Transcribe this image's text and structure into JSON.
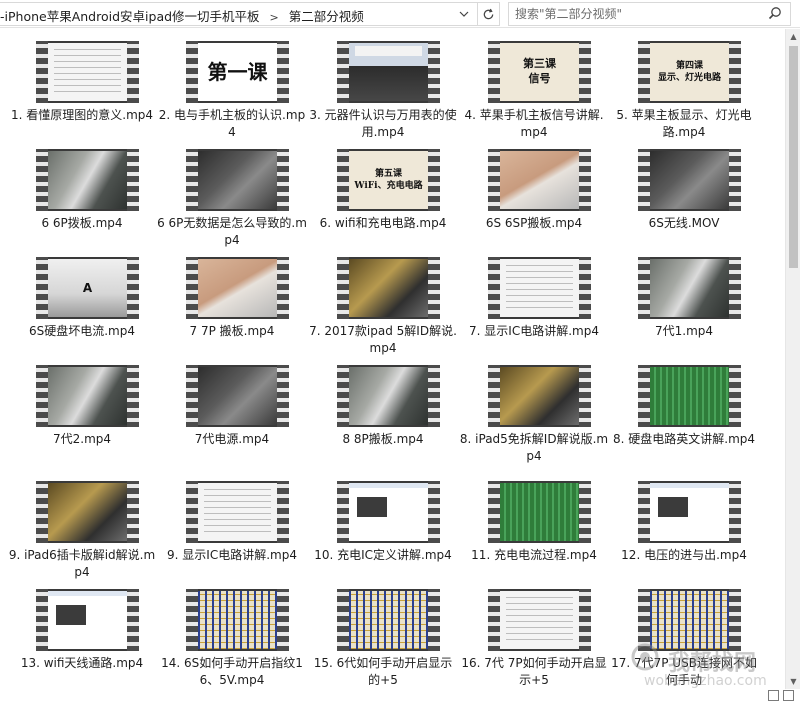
{
  "address_bar": {
    "path_parent": "-iPhone苹果Android安卓ipad修一切手机平板",
    "separator": ">",
    "path_current": "第二部分视频",
    "dropdown_glyph": "⌄",
    "refresh_glyph": "↻"
  },
  "search": {
    "placeholder": "搜索\"第二部分视频\"",
    "icon": "search-icon"
  },
  "files": [
    {
      "name": "1. 看懂原理图的意义.mp4",
      "thumb": "doc"
    },
    {
      "name": "2. 电与手机主板的认识.mp4",
      "thumb": "lesson",
      "frame_text": "第一课"
    },
    {
      "name": "3. 元器件认识与万用表的使用.mp4",
      "thumb": "class"
    },
    {
      "name": "4. 苹果手机主板信号讲解.mp4",
      "thumb": "paper",
      "frame_text": "第三课\n信号"
    },
    {
      "name": "5. 苹果主板显示、灯光电路.mp4",
      "thumb": "paper",
      "frame_text": "第四课\n显示、灯光电路"
    },
    {
      "name": "6 6P拨板.mp4",
      "thumb": "board"
    },
    {
      "name": "6 6P无数据是怎么导致的.mp4",
      "thumb": "dark"
    },
    {
      "name": "6.  wifi和充电电路.mp4",
      "thumb": "paper",
      "frame_text": "第五课\nWiFi、充电电路"
    },
    {
      "name": "6S 6SP搬板.mp4",
      "thumb": "hand"
    },
    {
      "name": "6S无线.MOV",
      "thumb": "dark"
    },
    {
      "name": "6S硬盘坏电流.mp4",
      "thumb": "meter",
      "frame_text": "A"
    },
    {
      "name": "7 7P 搬板.mp4",
      "thumb": "hand"
    },
    {
      "name": "7. 2017款ipad 5解ID解说.mp4",
      "thumb": "gold"
    },
    {
      "name": "7. 显示IC电路讲解.mp4",
      "thumb": "doc"
    },
    {
      "name": "7代1.mp4",
      "thumb": "board"
    },
    {
      "name": "7代2.mp4",
      "thumb": "board"
    },
    {
      "name": "7代电源.mp4",
      "thumb": "dark"
    },
    {
      "name": "8 8P搬板.mp4",
      "thumb": "board"
    },
    {
      "name": "8.  iPad5免拆解ID解说版.mp4",
      "thumb": "gold"
    },
    {
      "name": "8. 硬盘电路英文讲解.mp4",
      "thumb": "green"
    },
    {
      "name": "9.  iPad6插卡版解id解说.mp4",
      "thumb": "gold"
    },
    {
      "name": "9. 显示IC电路讲解.mp4",
      "thumb": "doc"
    },
    {
      "name": "10. 充电IC定义讲解.mp4",
      "thumb": "screen"
    },
    {
      "name": "11. 充电电流过程.mp4",
      "thumb": "green"
    },
    {
      "name": "12. 电压的进与出.mp4",
      "thumb": "screen"
    },
    {
      "name": "13. wifi天线通路.mp4",
      "thumb": "screen"
    },
    {
      "name": "14.  6S如何手动开启指纹16、5V.mp4",
      "thumb": "schem"
    },
    {
      "name": "15.  6代如何手动开启显示的+5",
      "thumb": "schem"
    },
    {
      "name": "16.  7代 7P如何手动开启显示+5",
      "thumb": "doc"
    },
    {
      "name": "17.  7代7P USB连接网不如何手动",
      "thumb": "schem"
    }
  ],
  "watermark": {
    "line1": "我帮找网",
    "line2": "wobangzhao.com"
  },
  "colors": {
    "background": "#ffffff",
    "film_strip": "#4b4b4b",
    "border": "#d9d9d9"
  }
}
